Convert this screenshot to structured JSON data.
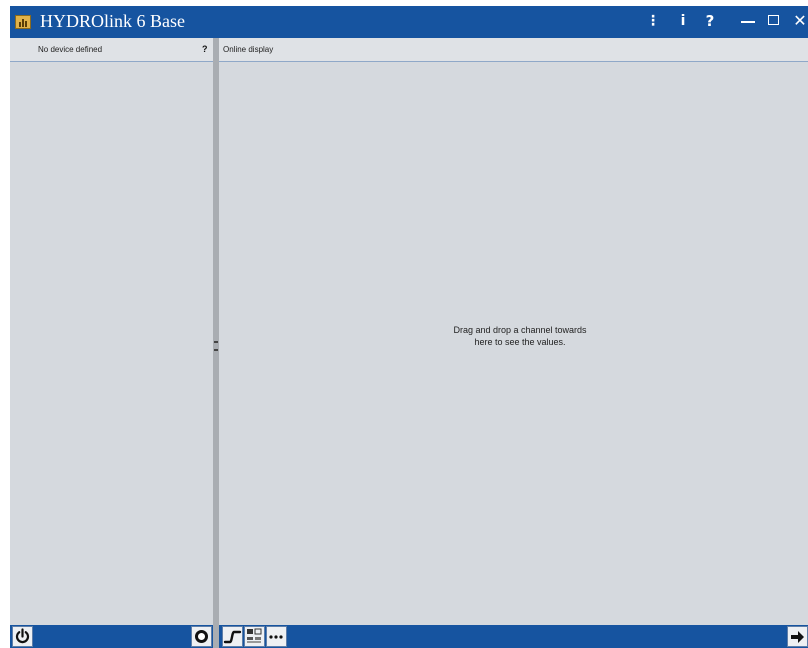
{
  "window": {
    "title": "HYDROlink 6 Base",
    "titlebar_color": "#1654a0",
    "app_icon": "bar-chart-app-icon"
  },
  "titlebar_controls": {
    "menu_label": "⋮",
    "info_label": "i",
    "help_label": "?",
    "minimize_icon": "minimize-icon",
    "maximize_icon": "maximize-icon",
    "close_label": "✕"
  },
  "left_panel": {
    "header": "No device defined",
    "help_label": "?"
  },
  "right_panel": {
    "header": "Online display",
    "drop_hint": "Drag and drop a channel towards here to see the values."
  },
  "bottom_left": {
    "power_icon": "power-icon",
    "record_icon": "record-icon"
  },
  "bottom_right": {
    "buttons": [
      {
        "icon": "step-chart-icon"
      },
      {
        "icon": "grid-display-icon"
      },
      {
        "icon": "more-dots-icon"
      },
      {
        "icon": "arrow-right-icon"
      }
    ]
  },
  "colors": {
    "panel_background": "#d5d9de",
    "accent": "#1654a0",
    "splitter": "#a9adb2"
  }
}
